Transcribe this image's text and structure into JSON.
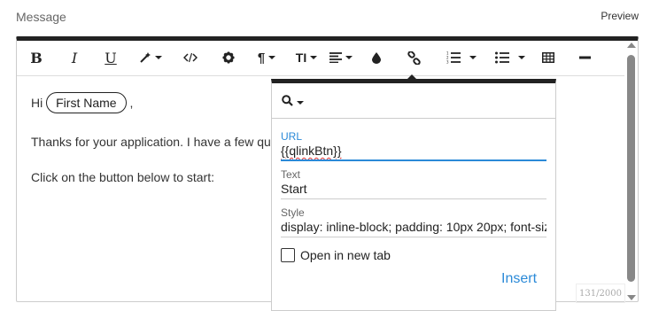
{
  "header": {
    "label": "Message",
    "preview": "Preview"
  },
  "toolbar": {
    "bold": "B",
    "italic": "I",
    "underline": "U",
    "paragraph_glyph": "¶",
    "fontsize_glyph": "TI"
  },
  "content": {
    "greeting": "Hi",
    "chip": "First Name",
    "comma": ",",
    "line2": "Thanks for your application. I have a few qu",
    "line3": "Click on the button below to start:"
  },
  "link_popover": {
    "url_label": "URL",
    "url_value": "{{qlinkBtn}}",
    "text_label": "Text",
    "text_value": "Start",
    "style_label": "Style",
    "style_value": "display: inline-block; padding: 10px 20px; font-siz",
    "open_new_tab_label": "Open in new tab",
    "open_new_tab_checked": false,
    "insert_label": "Insert"
  },
  "counter": "131/2000",
  "colors": {
    "accent": "#2b8ad8",
    "toolbar_border": "#222222"
  },
  "icons": [
    "magic-wand-icon",
    "code-icon",
    "gear-icon",
    "paragraph-icon",
    "font-size-icon",
    "align-icon",
    "color-drop-icon",
    "link-icon",
    "ordered-list-icon",
    "unordered-list-icon",
    "table-icon",
    "horizontal-rule-icon",
    "search-icon"
  ]
}
